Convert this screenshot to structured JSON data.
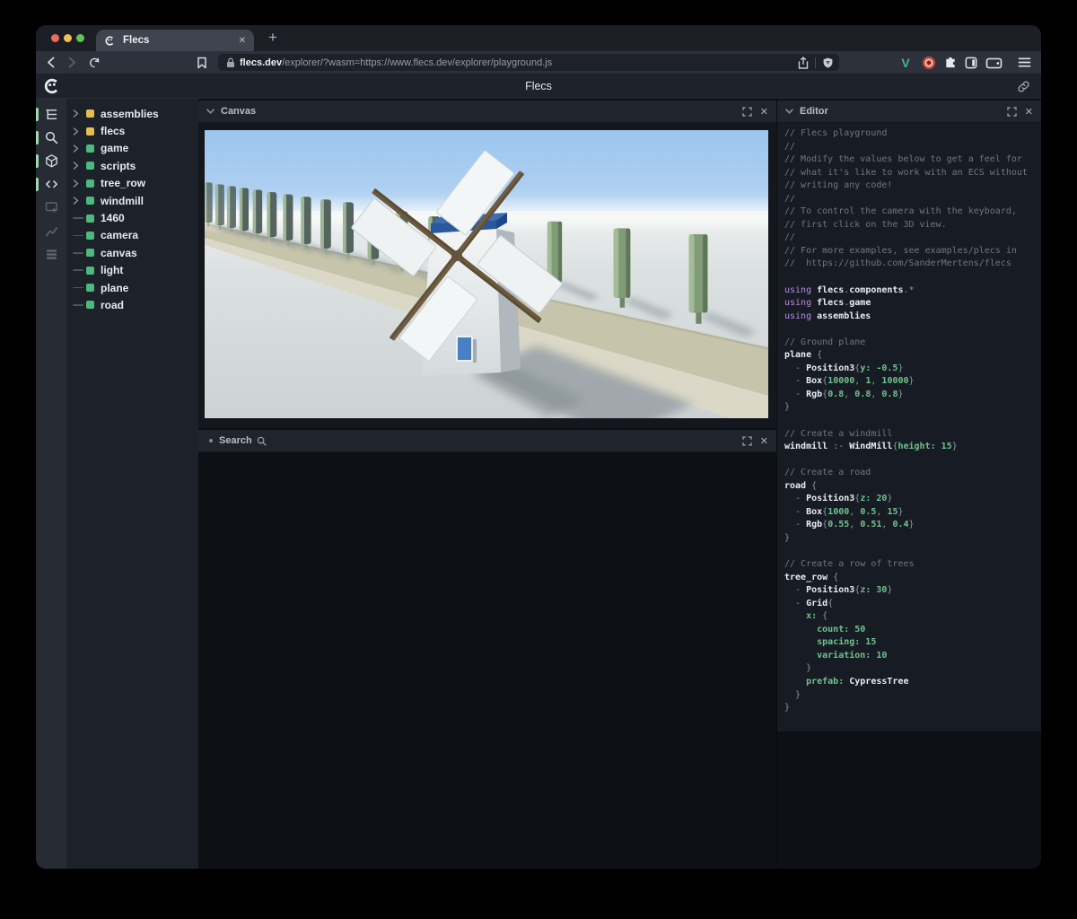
{
  "browser": {
    "tab": {
      "title": "Flecs"
    },
    "url": {
      "domain": "flecs.dev",
      "path": "/explorer/?wasm=https://www.flecs.dev/explorer/playground.js"
    },
    "extensions": {
      "vue_label": "V"
    }
  },
  "header": {
    "title": "Flecs"
  },
  "icons": {
    "close": "✕",
    "plus": "+"
  },
  "panels": {
    "canvas": {
      "title": "Canvas"
    },
    "search": {
      "title": "Search"
    },
    "editor": {
      "title": "Editor"
    }
  },
  "iconbar": {
    "active_color": "#a2d8ae",
    "items": [
      {
        "name": "entity-tree",
        "active": true
      },
      {
        "name": "query-search",
        "active": true
      },
      {
        "name": "canvas-3d",
        "active": true
      },
      {
        "name": "script-code",
        "active": true
      },
      {
        "name": "inspector",
        "active": false
      },
      {
        "name": "statistics",
        "active": false
      },
      {
        "name": "tables",
        "active": false
      }
    ]
  },
  "tree": {
    "items": [
      {
        "label": "assemblies",
        "color": "#e3bd4f",
        "expandable": true
      },
      {
        "label": "flecs",
        "color": "#e3bd4f",
        "expandable": true
      },
      {
        "label": "game",
        "color": "#4eb87f",
        "expandable": true
      },
      {
        "label": "scripts",
        "color": "#4eb87f",
        "expandable": true
      },
      {
        "label": "tree_row",
        "color": "#4eb87f",
        "expandable": true
      },
      {
        "label": "windmill",
        "color": "#4eb87f",
        "expandable": true
      },
      {
        "label": "1460",
        "color": "#4eb87f",
        "expandable": false
      },
      {
        "label": "camera",
        "color": "#4eb87f",
        "expandable": false
      },
      {
        "label": "canvas",
        "color": "#4eb87f",
        "expandable": false
      },
      {
        "label": "light",
        "color": "#4eb87f",
        "expandable": false
      },
      {
        "label": "plane",
        "color": "#4eb87f",
        "expandable": false
      },
      {
        "label": "road",
        "color": "#4eb87f",
        "expandable": false
      }
    ]
  },
  "scene": {
    "sky": "#9cc5ee",
    "ground": "#d6dbdc",
    "road_top": "#c7c4ac",
    "road_front": "#dbd8c8",
    "tree_green": "#819a78",
    "tree_dark": "#55645e",
    "windmill_body": "#e9eced",
    "windmill_cap": "#2b589c",
    "door": "#4a7fc3",
    "blade_wood": "#705e44",
    "sail": "#f3f6f6"
  },
  "editor": {
    "code_lines": [
      [
        [
          "c",
          "// Flecs playground"
        ]
      ],
      [
        [
          "c",
          "//"
        ]
      ],
      [
        [
          "c",
          "// Modify the values below to get a feel for"
        ]
      ],
      [
        [
          "c",
          "// what it's like to work with an ECS without"
        ]
      ],
      [
        [
          "c",
          "// writing any code!"
        ]
      ],
      [
        [
          "c",
          "//"
        ]
      ],
      [
        [
          "c",
          "// To control the camera with the keyboard,"
        ]
      ],
      [
        [
          "c",
          "// first click on the 3D view."
        ]
      ],
      [
        [
          "c",
          "//"
        ]
      ],
      [
        [
          "c",
          "// For more examples, see examples/plecs in"
        ]
      ],
      [
        [
          "c",
          "//  https://github.com/SanderMertens/flecs"
        ]
      ],
      [],
      [
        [
          "k",
          "using "
        ],
        [
          "i",
          "flecs"
        ],
        [
          "p",
          "."
        ],
        [
          "i",
          "components"
        ],
        [
          "p",
          ".*"
        ]
      ],
      [
        [
          "k",
          "using "
        ],
        [
          "i",
          "flecs"
        ],
        [
          "p",
          "."
        ],
        [
          "i",
          "game"
        ]
      ],
      [
        [
          "k",
          "using "
        ],
        [
          "i",
          "assemblies"
        ]
      ],
      [],
      [
        [
          "c",
          "// Ground plane"
        ]
      ],
      [
        [
          "i",
          "plane"
        ],
        [
          "p",
          " {"
        ]
      ],
      [
        [
          "p",
          "  - "
        ],
        [
          "i",
          "Position3"
        ],
        [
          "p",
          "{"
        ],
        [
          "g",
          "y: -0.5"
        ],
        [
          "p",
          "}"
        ]
      ],
      [
        [
          "p",
          "  - "
        ],
        [
          "i",
          "Box"
        ],
        [
          "p",
          "{"
        ],
        [
          "g",
          "10000"
        ],
        [
          "p",
          ", "
        ],
        [
          "g",
          "1"
        ],
        [
          "p",
          ", "
        ],
        [
          "g",
          "10000"
        ],
        [
          "p",
          "}"
        ]
      ],
      [
        [
          "p",
          "  - "
        ],
        [
          "i",
          "Rgb"
        ],
        [
          "p",
          "{"
        ],
        [
          "g",
          "0.8"
        ],
        [
          "p",
          ", "
        ],
        [
          "g",
          "0.8"
        ],
        [
          "p",
          ", "
        ],
        [
          "g",
          "0.8"
        ],
        [
          "p",
          "}"
        ]
      ],
      [
        [
          "p",
          "}"
        ]
      ],
      [],
      [
        [
          "c",
          "// Create a windmill"
        ]
      ],
      [
        [
          "i",
          "windmill"
        ],
        [
          "p",
          " :- "
        ],
        [
          "i",
          "WindMill"
        ],
        [
          "p",
          "{"
        ],
        [
          "g",
          "height: 15"
        ],
        [
          "p",
          "}"
        ]
      ],
      [],
      [
        [
          "c",
          "// Create a road"
        ]
      ],
      [
        [
          "i",
          "road"
        ],
        [
          "p",
          " {"
        ]
      ],
      [
        [
          "p",
          "  - "
        ],
        [
          "i",
          "Position3"
        ],
        [
          "p",
          "{"
        ],
        [
          "g",
          "z: 20"
        ],
        [
          "p",
          "}"
        ]
      ],
      [
        [
          "p",
          "  - "
        ],
        [
          "i",
          "Box"
        ],
        [
          "p",
          "{"
        ],
        [
          "g",
          "1000"
        ],
        [
          "p",
          ", "
        ],
        [
          "g",
          "0.5"
        ],
        [
          "p",
          ", "
        ],
        [
          "g",
          "15"
        ],
        [
          "p",
          "}"
        ]
      ],
      [
        [
          "p",
          "  - "
        ],
        [
          "i",
          "Rgb"
        ],
        [
          "p",
          "{"
        ],
        [
          "g",
          "0.55"
        ],
        [
          "p",
          ", "
        ],
        [
          "g",
          "0.51"
        ],
        [
          "p",
          ", "
        ],
        [
          "g",
          "0.4"
        ],
        [
          "p",
          "}"
        ]
      ],
      [
        [
          "p",
          "}"
        ]
      ],
      [],
      [
        [
          "c",
          "// Create a row of trees"
        ]
      ],
      [
        [
          "i",
          "tree_row"
        ],
        [
          "p",
          " {"
        ]
      ],
      [
        [
          "p",
          "  - "
        ],
        [
          "i",
          "Position3"
        ],
        [
          "p",
          "{"
        ],
        [
          "g",
          "z: 30"
        ],
        [
          "p",
          "}"
        ]
      ],
      [
        [
          "p",
          "  - "
        ],
        [
          "i",
          "Grid"
        ],
        [
          "p",
          "{"
        ]
      ],
      [
        [
          "g",
          "    x: "
        ],
        [
          "p",
          "{"
        ]
      ],
      [
        [
          "g",
          "      count: 50"
        ]
      ],
      [
        [
          "g",
          "      spacing: 15"
        ]
      ],
      [
        [
          "g",
          "      variation: 10"
        ]
      ],
      [
        [
          "p",
          "    }"
        ]
      ],
      [
        [
          "g",
          "    prefab: "
        ],
        [
          "i",
          "CypressTree"
        ]
      ],
      [
        [
          "p",
          "  }"
        ]
      ],
      [
        [
          "p",
          "}"
        ]
      ]
    ]
  }
}
